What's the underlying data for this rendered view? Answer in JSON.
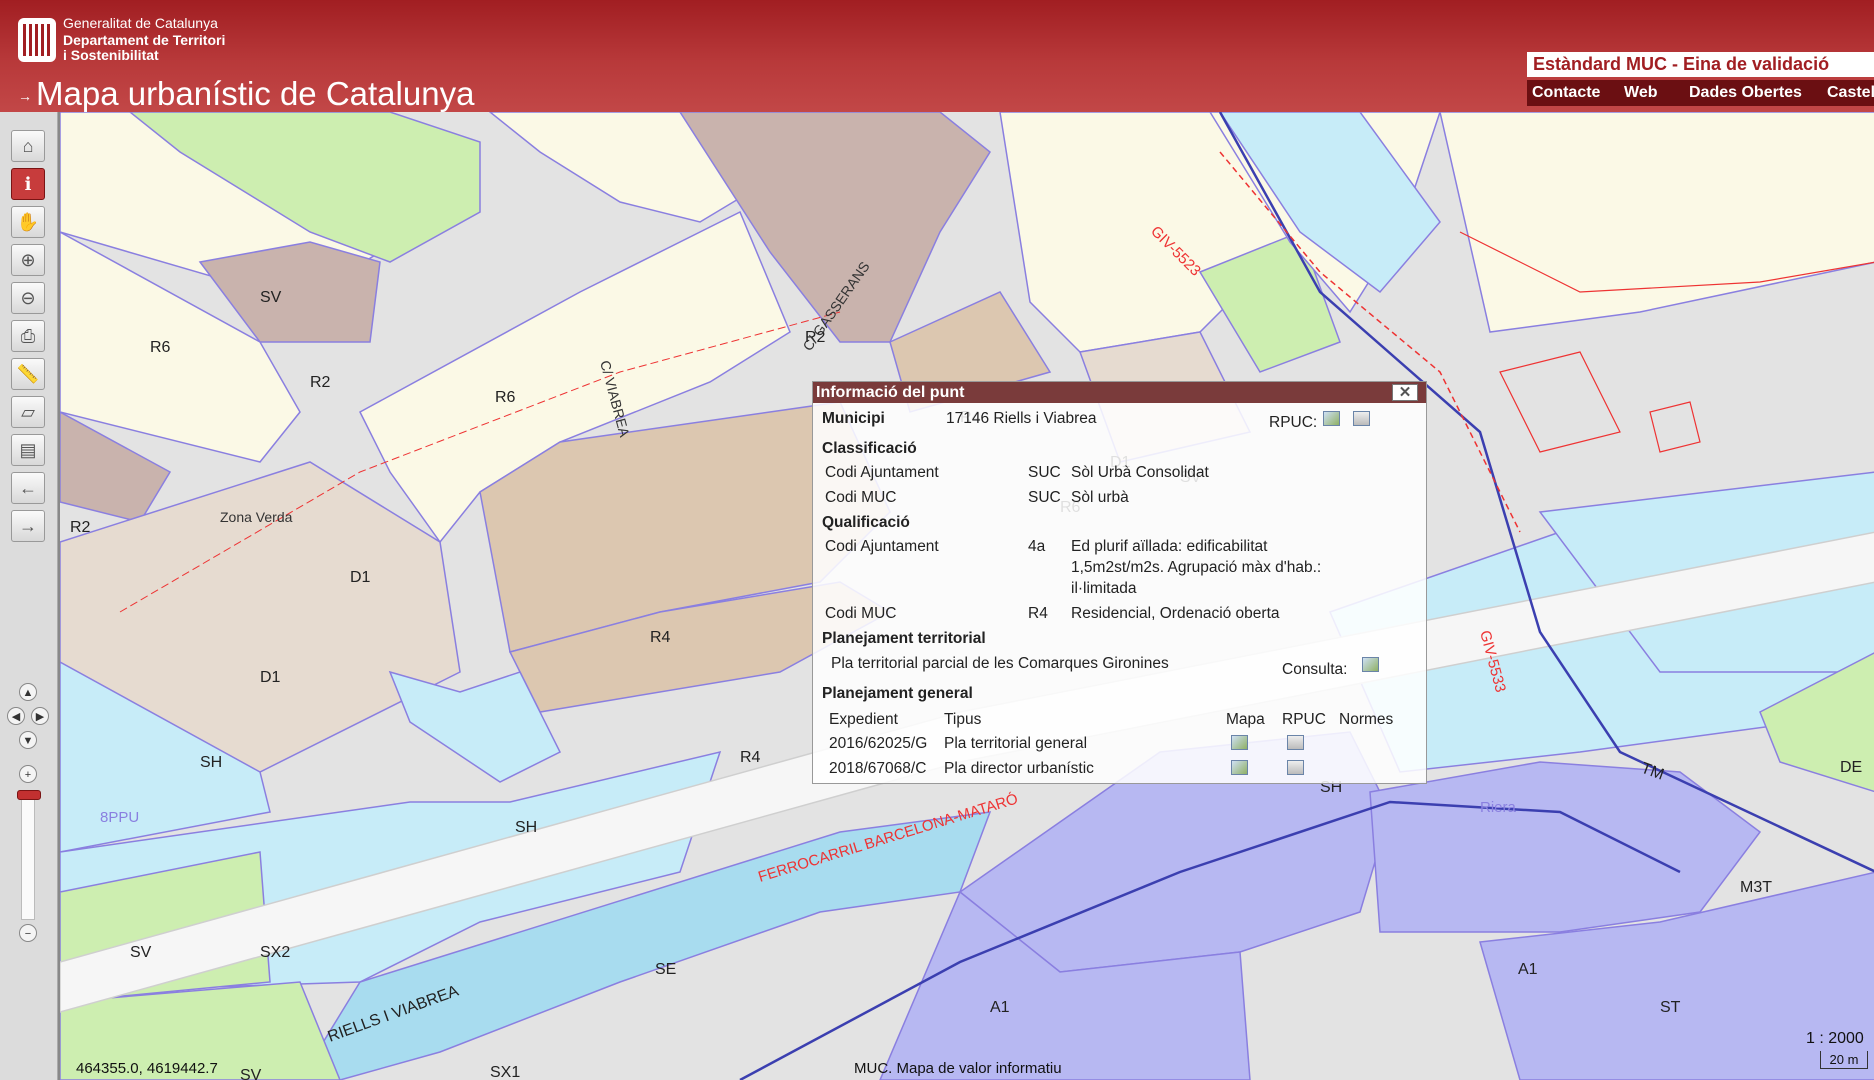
{
  "header": {
    "org_lines": [
      "Generalitat de Catalunya",
      "Departament de Territori",
      "i Sostenibilitat"
    ],
    "app_arrow": "→",
    "app_title": "Mapa urbanístic de Catalunya",
    "tool_title": "Estàndard MUC - Eina de validació",
    "links": [
      "Contacte",
      "Web",
      "Dades Obertes",
      "Castellà"
    ]
  },
  "toolbar": {
    "buttons": [
      {
        "name": "home-icon",
        "glyph": "⌂"
      },
      {
        "name": "info-icon",
        "glyph": "ℹ"
      },
      {
        "name": "pan-hand-icon",
        "glyph": "✋"
      },
      {
        "name": "zoom-in-box-icon",
        "glyph": "⊕"
      },
      {
        "name": "zoom-out-box-icon",
        "glyph": "⊖"
      },
      {
        "name": "print-icon",
        "glyph": "⎙"
      },
      {
        "name": "measure-distance-icon",
        "glyph": "📏"
      },
      {
        "name": "measure-area-icon",
        "glyph": "▱"
      },
      {
        "name": "layers-icon",
        "glyph": "▤"
      },
      {
        "name": "previous-view-icon",
        "glyph": "←"
      },
      {
        "name": "next-view-icon",
        "glyph": "→"
      }
    ],
    "active_index": 1,
    "nav": {
      "up": "▲",
      "left": "◀",
      "right": "▶",
      "down": "▼",
      "zoom_in": "+",
      "zoom_out": "−"
    }
  },
  "map": {
    "coordinates": "464355.0, 4619442.7",
    "note": "MUC. Mapa de valor informatiu",
    "scale_text": "1 : 2000",
    "scale_bar": "20 m",
    "colors": {
      "R6": "#fbf9e6",
      "R2": "#c9b3ad",
      "R4": "#dcc7b0",
      "SV": "#cdeeb0",
      "SH": "#c7ecf8",
      "SE": "#a8dcef",
      "A1": "#b7b8f2",
      "D1": "#e6dbd0",
      "road": "#e3e3e3"
    },
    "labels": [
      "R6",
      "R2",
      "R4",
      "SV",
      "SX2",
      "SX1",
      "SH",
      "SE",
      "D1",
      "A1",
      "ST",
      "M3T",
      "DE",
      "TM",
      "Zona Verda",
      "8PPU",
      "RIELLS I VIABREA",
      "FERROCARRIL BARCELONA-MATARÓ",
      "GIV-5523",
      "GIV-5533",
      "C/ GASSERANS",
      "C/ VIABREA",
      "Riera"
    ]
  },
  "popup": {
    "title": "Informació del punt",
    "close": "✕",
    "municipi_label": "Municipi",
    "municipi_value": "17146 Riells i Viabrea",
    "rpuc_label": "RPUC:",
    "classificacio": {
      "heading": "Classificació",
      "rows": [
        {
          "label": "Codi Ajuntament",
          "code": "SUC",
          "desc": "Sòl Urbà Consolidat"
        },
        {
          "label": "Codi MUC",
          "code": "SUC",
          "desc": "Sòl urbà"
        }
      ]
    },
    "qualificacio": {
      "heading": "Qualificació",
      "rows": [
        {
          "label": "Codi Ajuntament",
          "code": "4a",
          "desc_lines": [
            "Ed plurif aïllada: edificabilitat",
            "1,5m2st/m2s. Agrupació màx d'hab.:",
            "il·limitada"
          ]
        },
        {
          "label": "Codi MUC",
          "code": "R4",
          "desc_lines": [
            "Residencial, Ordenació oberta"
          ]
        }
      ]
    },
    "territorial": {
      "heading": "Planejament territorial",
      "plan": "Pla territorial parcial de les Comarques Gironines",
      "consulta_label": "Consulta:"
    },
    "general": {
      "heading": "Planejament general",
      "columns": [
        "Expedient",
        "Tipus",
        "Mapa",
        "RPUC",
        "Normes"
      ],
      "rows": [
        {
          "expedient": "2016/62025/G",
          "tipus": "Pla territorial general"
        },
        {
          "expedient": "2018/67068/C",
          "tipus": "Pla director urbanístic"
        }
      ]
    }
  }
}
